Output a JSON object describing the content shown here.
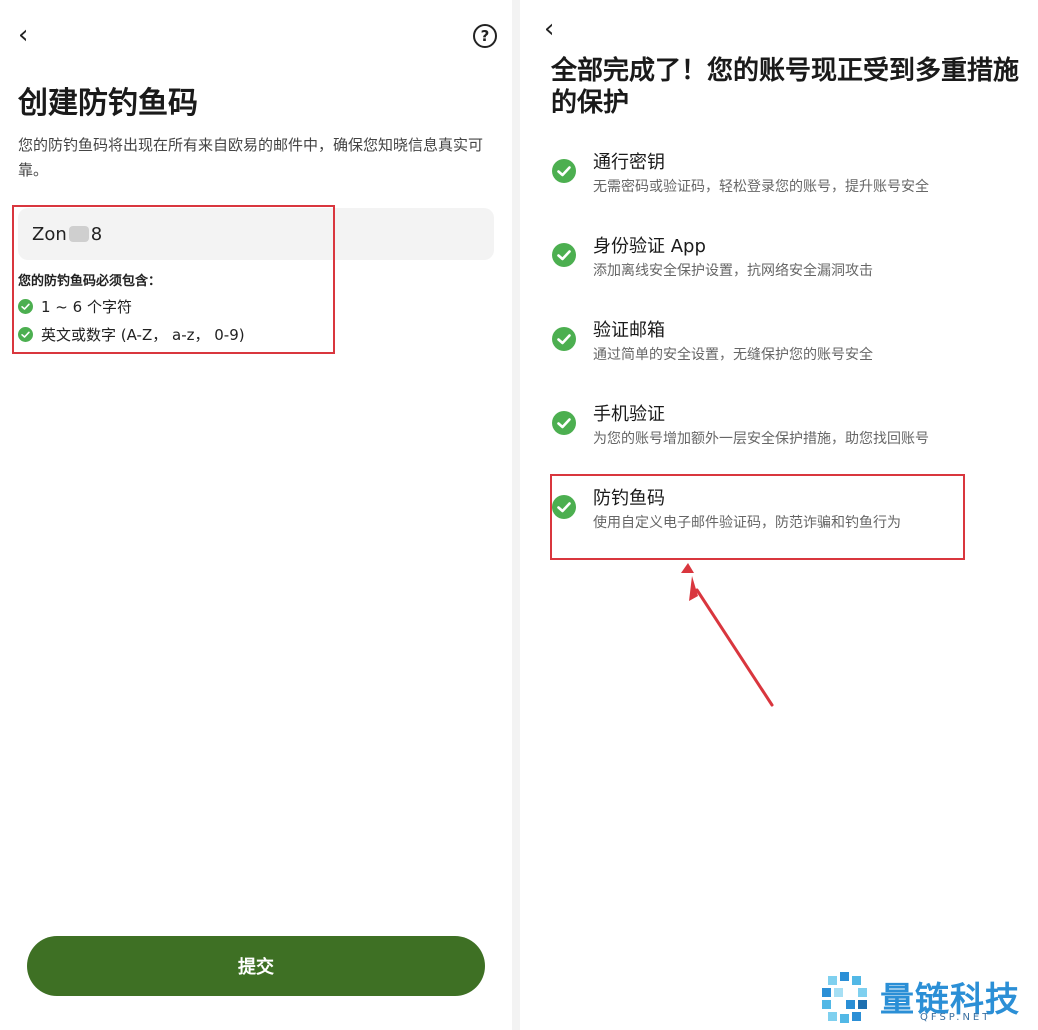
{
  "left": {
    "back_glyph": "‹",
    "help_glyph": "?",
    "title": "创建防钓鱼码",
    "description": "您的防钓鱼码将出现在所有来自欧易的邮件中，确保您知晓信息真实可靠。",
    "input": {
      "prefix": "Zon",
      "suffix": "8"
    },
    "requirements_title": "您的防钓鱼码必须包含：",
    "requirements": [
      {
        "label": "1 ~ 6 个字符"
      },
      {
        "label": "英文或数字 (A-Z， a-z， 0-9)"
      }
    ],
    "submit_label": "提交"
  },
  "right": {
    "back_glyph": "‹",
    "title": "全部完成了！您的账号现正受到多重措施的保护",
    "items": [
      {
        "title": "通行密钥",
        "desc": "无需密码或验证码，轻松登录您的账号，提升账号安全"
      },
      {
        "title": "身份验证 App",
        "desc": "添加离线安全保护设置，抗网络安全漏洞攻击"
      },
      {
        "title": "验证邮箱",
        "desc": "通过简单的安全设置，无缝保护您的账号安全"
      },
      {
        "title": "手机验证",
        "desc": "为您的账号增加额外一层安全保护措施，助您找回账号"
      },
      {
        "title": "防钓鱼码",
        "desc": "使用自定义电子邮件验证码，防范诈骗和钓鱼行为"
      }
    ]
  },
  "watermark": {
    "name": "量链科技",
    "domain": "QFSP.NET"
  },
  "colors": {
    "accent_green": "#3e7024",
    "check_green": "#4caf50",
    "highlight_red": "#d9363e",
    "logo_blue": "#2b8fd6"
  },
  "icons": {
    "back": "chevron-left-icon",
    "help": "question-circle-icon",
    "check": "check-circle-icon"
  }
}
